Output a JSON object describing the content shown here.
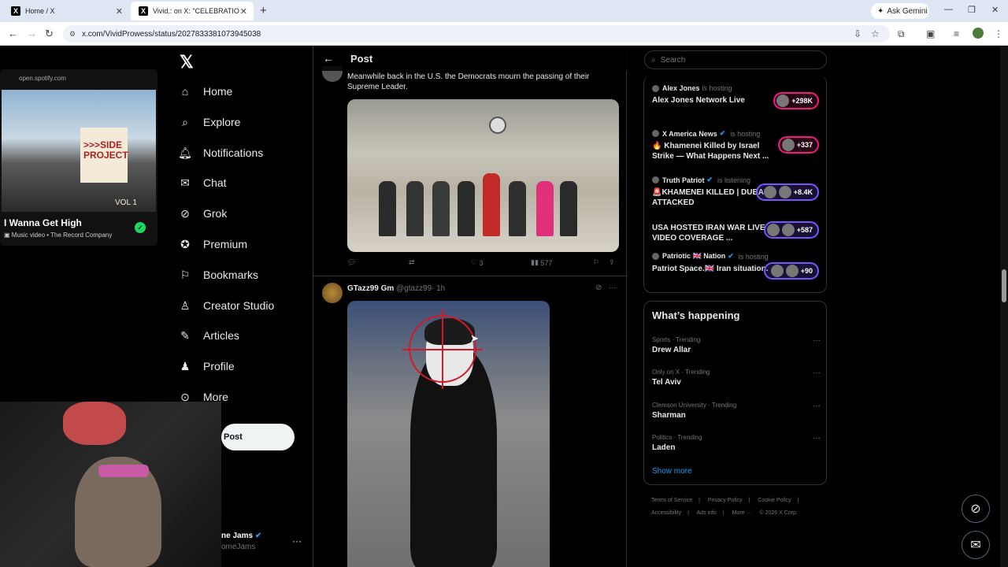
{
  "browser": {
    "tabs": [
      {
        "title": "Home / X"
      },
      {
        "title": "Vivid.: on X: \"CELEBRATIO"
      }
    ],
    "url": "x.com/VividProwess/status/2027833381073945038",
    "ask_gemini": "Ask Gemini"
  },
  "pip": {
    "source": "open.spotify.com",
    "song_title": "I Wanna Get High",
    "subtitle": "Music video • The Record Company",
    "art_text": ">>>SIDE PROJECT",
    "art_vol": "VOL 1"
  },
  "nav": {
    "items": [
      {
        "label": "Home"
      },
      {
        "label": "Explore"
      },
      {
        "label": "Notifications"
      },
      {
        "label": "Chat"
      },
      {
        "label": "Grok"
      },
      {
        "label": "Premium"
      },
      {
        "label": "Bookmarks"
      },
      {
        "label": "Creator Studio"
      },
      {
        "label": "Articles"
      },
      {
        "label": "Profile"
      },
      {
        "label": "More"
      }
    ],
    "post_button": "Post",
    "account_name": "ne Jams",
    "account_handle": "omeJams"
  },
  "center": {
    "header_title": "Post",
    "tweet1": {
      "text": "Meanwhile back in the U.S. the Democrats mourn the passing of their Supreme Leader.",
      "likes": "3",
      "views": "577"
    },
    "tweet2": {
      "name": "GTazz99 Gm",
      "handle": "@gtazz99",
      "time": "· 1h"
    }
  },
  "right": {
    "search_placeholder": "Search",
    "spaces": [
      {
        "host": "Alex Jones",
        "status": "is hosting",
        "title": "Alex Jones Network Live",
        "count": "+298K",
        "pill": "red",
        "verified": false
      },
      {
        "host": "X America News",
        "status": "is hosting",
        "title": "🔥 Khamenei Killed by Israel Strike — What Happens Next ...",
        "count": "+337",
        "pill": "red",
        "verified": true
      },
      {
        "host": "Truth Patriot",
        "status": "is listening",
        "title": "🚨KHAMENEI KILLED | DUBAI ATTACKED",
        "count": "+8.4K",
        "pill": "purple",
        "verified": true
      },
      {
        "host": "",
        "status": "",
        "title": "USA HOSTED IRAN WAR LIVE VIDEO COVERAGE ...",
        "count": "+587",
        "pill": "purple",
        "verified": false
      },
      {
        "host": "Patriotic 🇬🇧 Nation",
        "status": "is hosting",
        "title": "Patriot Space.🇬🇧 Iran situation.",
        "count": "+90",
        "pill": "purple",
        "verified": true
      }
    ],
    "happening_title": "What’s happening",
    "trends": [
      {
        "meta": "Sports · Trending",
        "name": "Drew Allar"
      },
      {
        "meta": "Only on X · Trending",
        "name": "Tel Aviv"
      },
      {
        "meta": "Clemson University · Trending",
        "name": "Sharman"
      },
      {
        "meta": "Politics · Trending",
        "name": "Laden"
      }
    ],
    "show_more": "Show more",
    "footer": [
      "Terms of Service",
      "|",
      "Privacy Policy",
      "|",
      "Cookie Policy",
      "|",
      "Accessibility",
      "|",
      "Ads info",
      "|",
      "More ···",
      "© 2026 X Corp."
    ]
  },
  "colors": {
    "accent": "#1d9bf0",
    "space_red": "#f91880",
    "space_purple": "#7856ff"
  }
}
